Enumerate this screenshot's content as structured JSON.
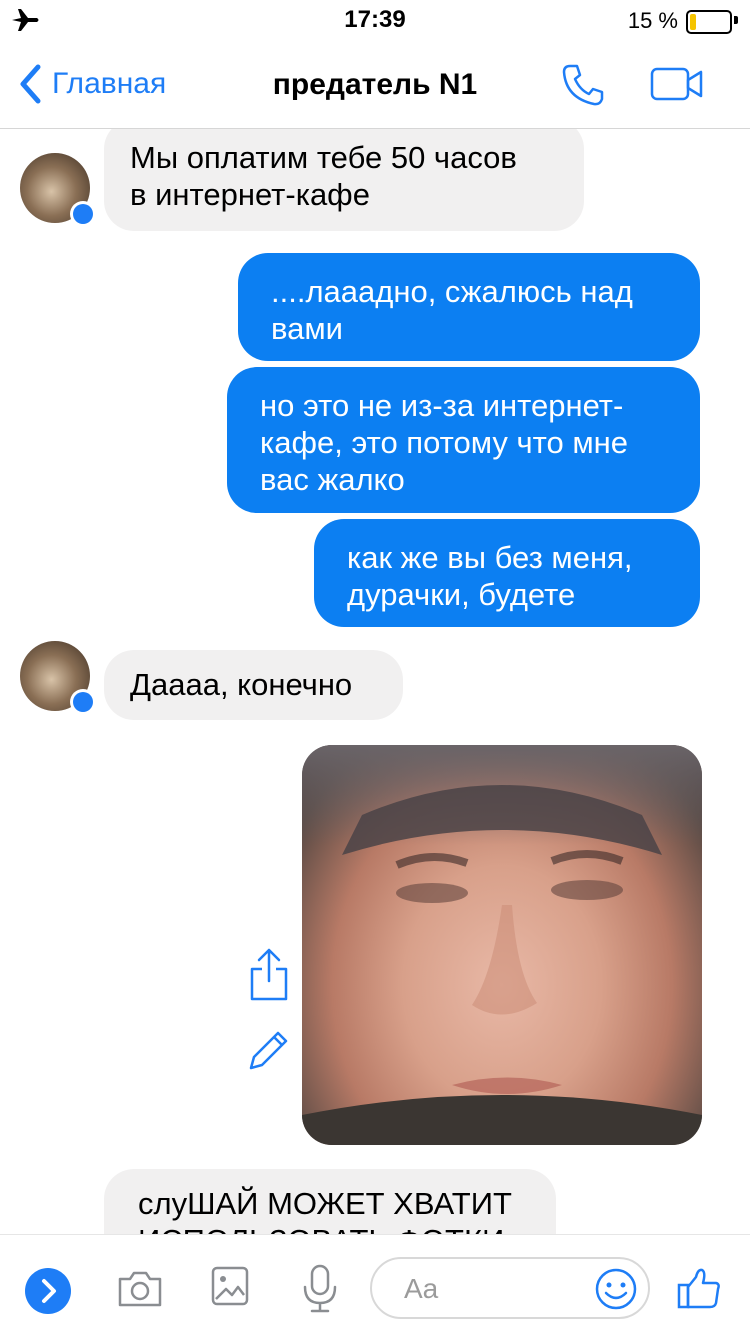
{
  "status_bar": {
    "time": "17:39",
    "battery": "15 %",
    "battery_level": 0.15
  },
  "nav": {
    "back_label": "Главная",
    "title": "предатель N1"
  },
  "messages": [
    {
      "side": "in",
      "text": "Мы оплатим тебе 50 часов\nв интернет-кафе"
    },
    {
      "side": "out",
      "text": "....лаааднo, сжалюсь над\nвами"
    },
    {
      "side": "out",
      "text": "но это не из-за интернет-\nкафе, это потому что мне\nвас жалко"
    },
    {
      "side": "out",
      "text": "как же вы без меня,\nдурачки, будете"
    },
    {
      "side": "in",
      "text": "Даааа, конечно"
    },
    {
      "side": "in",
      "text": "слуШАЙ МОЖЕТ ХВАТИТ\nИСПОЛЬЗОВАТЬ ФОТКИ"
    }
  ],
  "composer": {
    "placeholder": "Aa"
  },
  "colors": {
    "accent": "#1e7df6",
    "outgoing_bubble": "#0c7ff2",
    "incoming_bubble": "#f1f0f0"
  },
  "icons": [
    "airplane-icon",
    "phone-icon",
    "video-camera-icon",
    "messenger-badge-icon",
    "share-icon",
    "edit-pencil-icon",
    "chevron-right-icon",
    "camera-icon",
    "gallery-icon",
    "microphone-icon",
    "smiley-icon",
    "thumbs-up-icon"
  ]
}
